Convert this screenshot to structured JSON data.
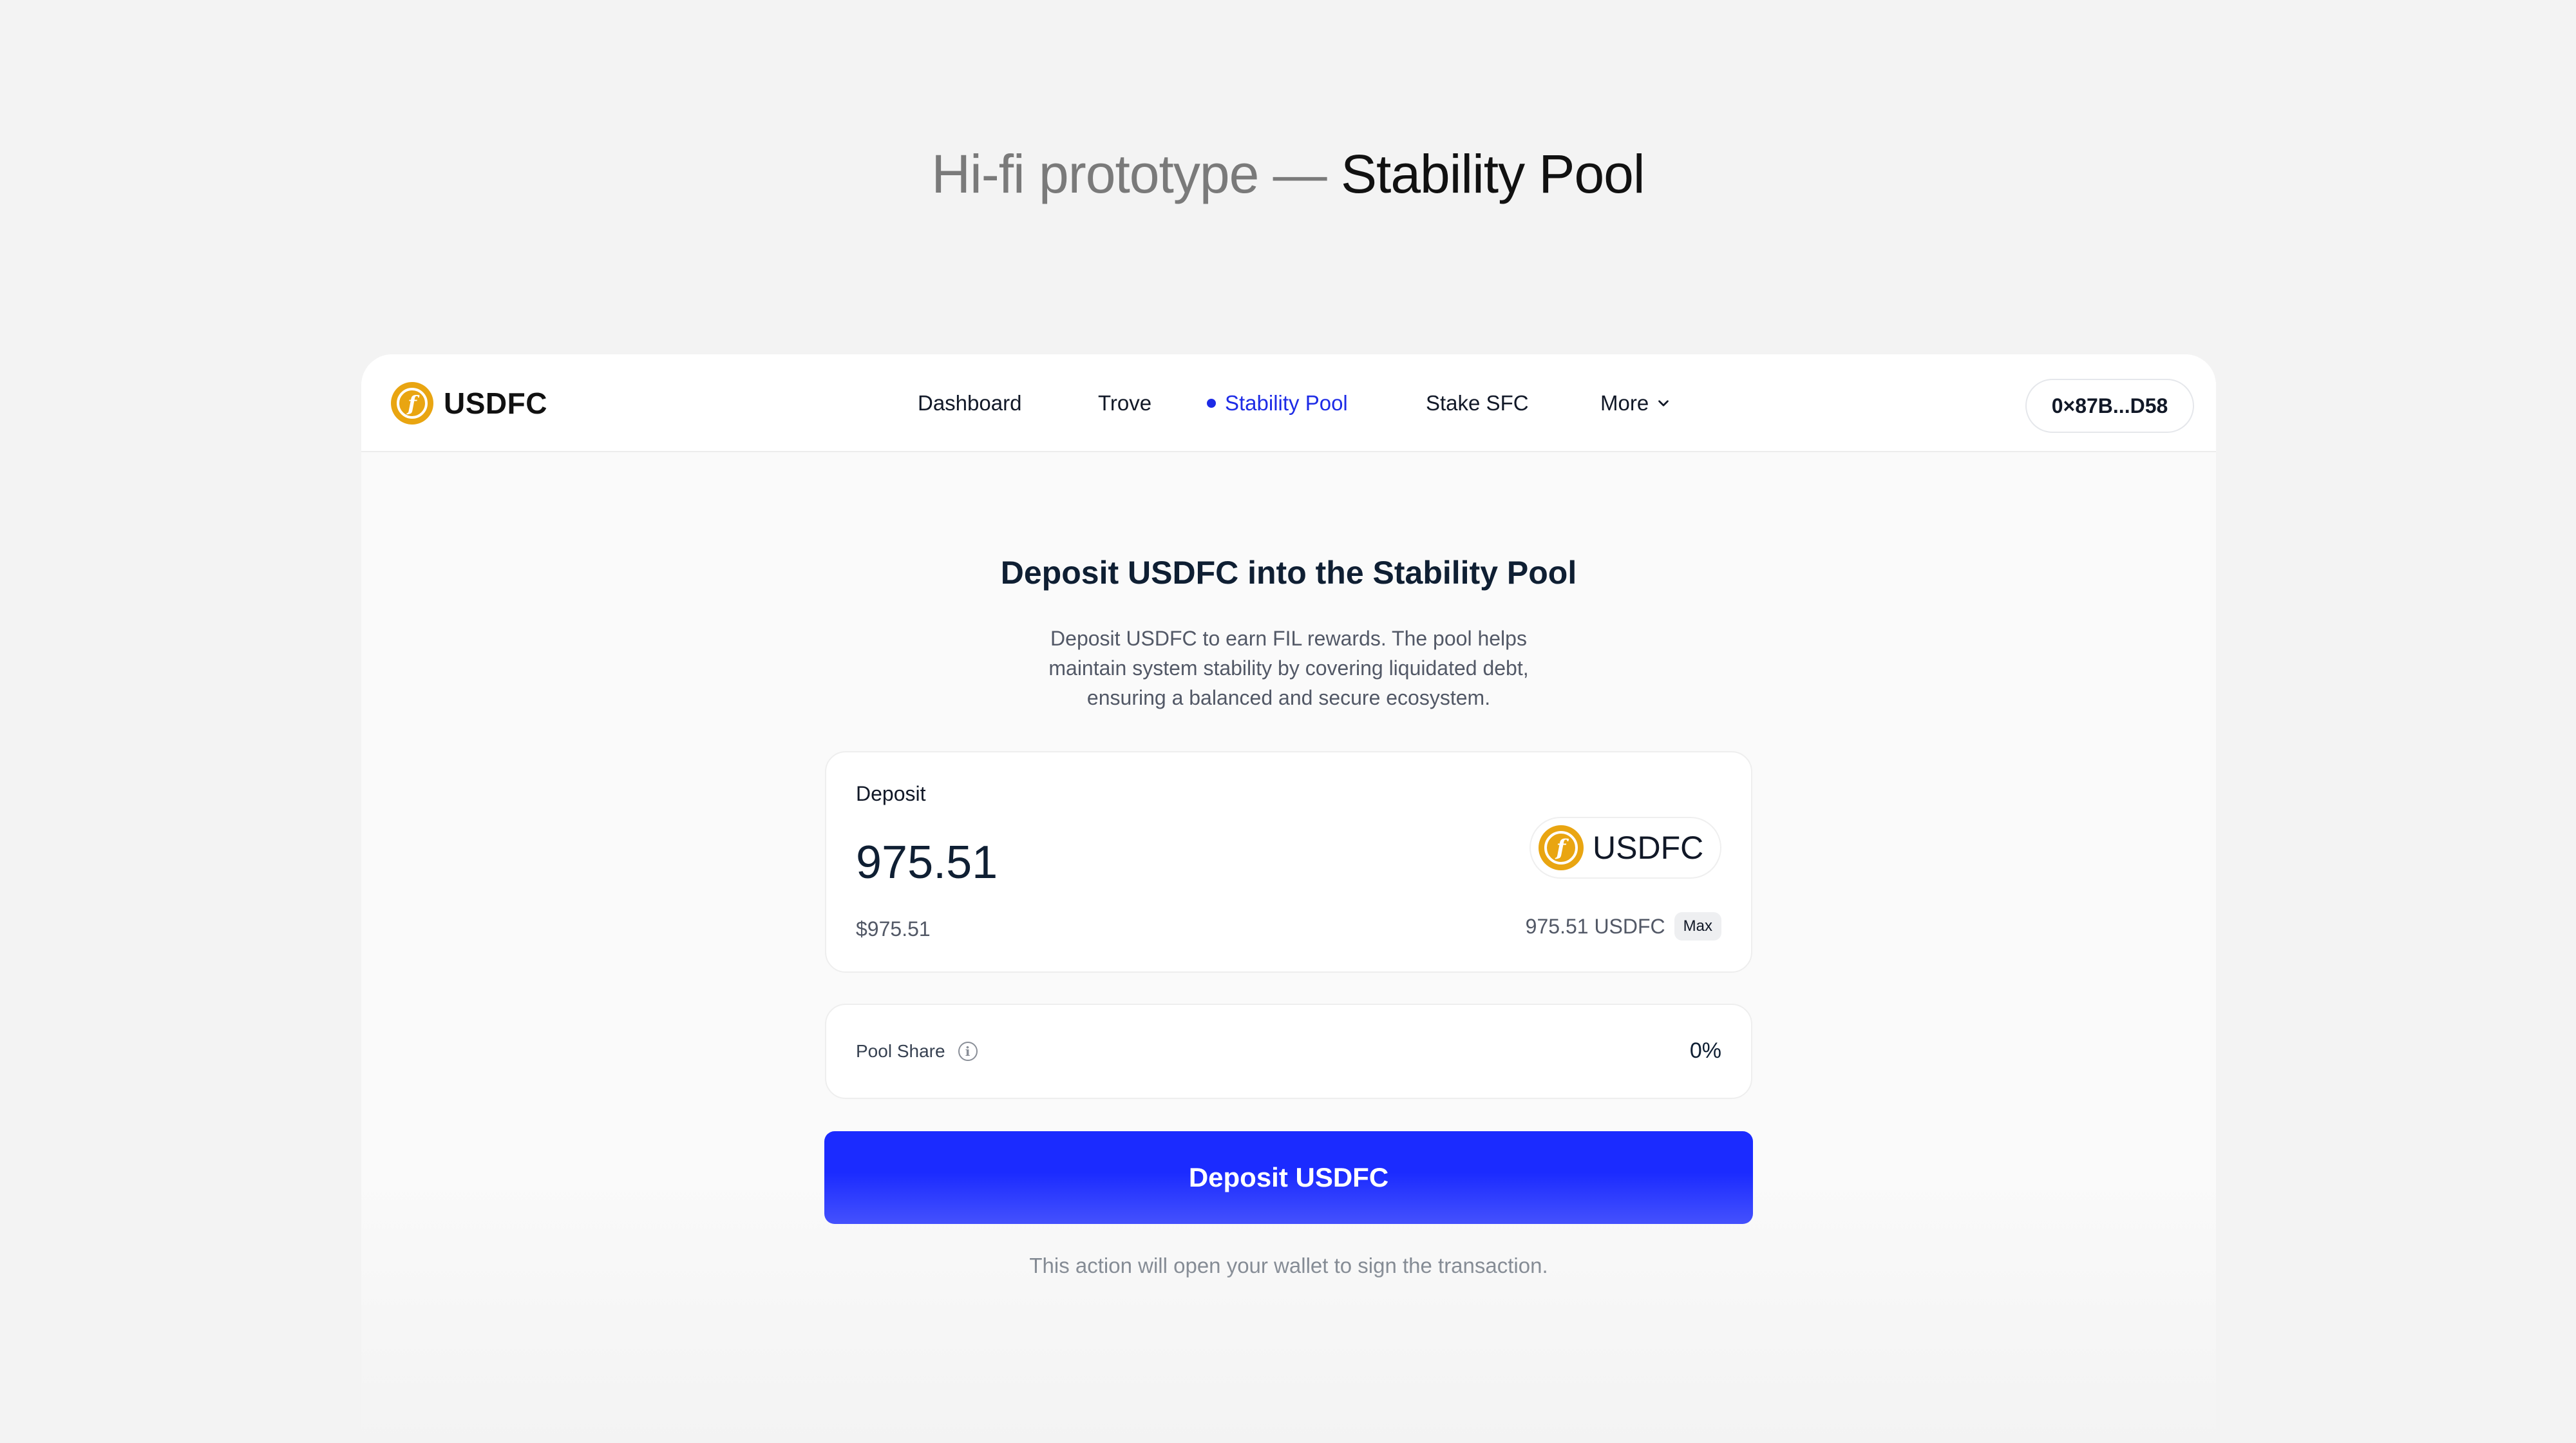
{
  "page": {
    "heading_prefix": "Hi-fi prototype — ",
    "heading_accent": "Stability Pool"
  },
  "navbar": {
    "brand": "USDFC",
    "brand_icon": "usdfc-coin-icon",
    "items": [
      {
        "label": "Dashboard",
        "active": false
      },
      {
        "label": "Trove",
        "active": false
      },
      {
        "label": "Stability Pool",
        "active": true
      },
      {
        "label": "Stake SFC",
        "active": false
      },
      {
        "label": "More",
        "active": false,
        "has_dropdown": true
      }
    ],
    "wallet": "0×87B...D58"
  },
  "main": {
    "title": "Deposit USDFC into the Stability Pool",
    "description": "Deposit USDFC to earn FIL rewards. The pool helps maintain system stability by covering liquidated debt, ensuring a balanced and secure ecosystem.",
    "deposit": {
      "label": "Deposit",
      "amount": "975.51",
      "usd_value": "$975.51",
      "token": "USDFC",
      "balance": "975.51 USDFC",
      "max_label": "Max"
    },
    "pool_share": {
      "label": "Pool Share",
      "value": "0%"
    },
    "submit_label": "Deposit USDFC",
    "footnote": "This action will open your wallet to sign the transaction."
  },
  "colors": {
    "accent": "#1b2bff",
    "active_nav": "#1d2be6",
    "coin": "#e9a511",
    "background": "#f3f3f3"
  }
}
